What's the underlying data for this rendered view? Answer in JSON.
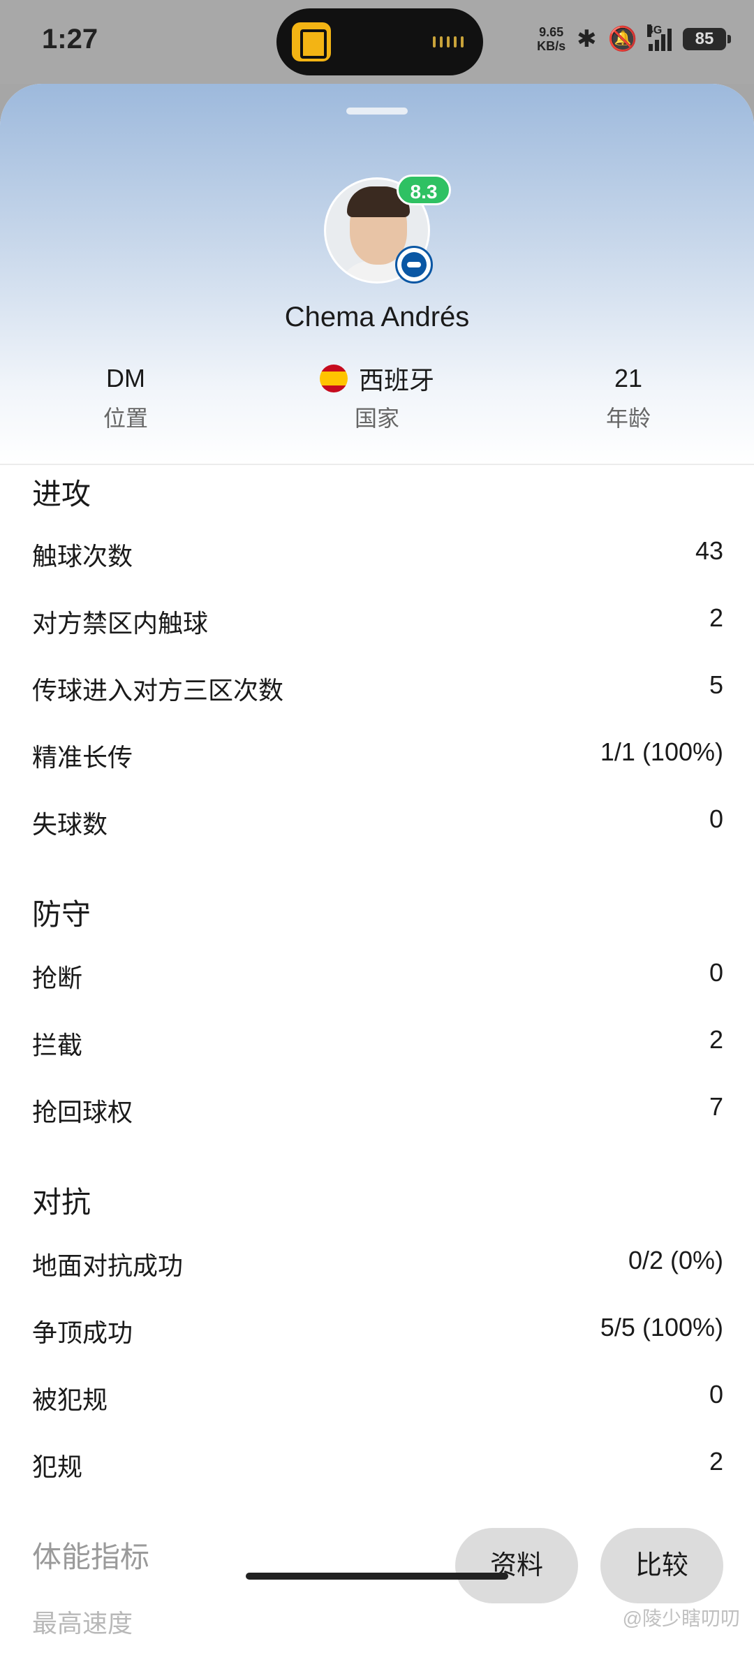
{
  "status_bar": {
    "time": "1:27",
    "net_speed_value": "9.65",
    "net_speed_unit": "KB/s",
    "network": "4G",
    "battery": "85"
  },
  "player": {
    "name": "Chema Andrés",
    "rating": "8.3",
    "position_value": "DM",
    "position_label": "位置",
    "country_value": "西班牙",
    "country_label": "国家",
    "age_value": "21",
    "age_label": "年龄"
  },
  "sections": {
    "attack": {
      "title": "进攻",
      "rows": [
        {
          "label": "触球次数",
          "value": "43"
        },
        {
          "label": "对方禁区内触球",
          "value": "2"
        },
        {
          "label": "传球进入对方三区次数",
          "value": "5"
        },
        {
          "label": "精准长传",
          "value": "1/1 (100%)"
        },
        {
          "label": "失球数",
          "value": "0"
        }
      ]
    },
    "defense": {
      "title": "防守",
      "rows": [
        {
          "label": "抢断",
          "value": "0"
        },
        {
          "label": "拦截",
          "value": "2"
        },
        {
          "label": "抢回球权",
          "value": "7"
        }
      ]
    },
    "duels": {
      "title": "对抗",
      "rows": [
        {
          "label": "地面对抗成功",
          "value": "0/2 (0%)"
        },
        {
          "label": "争顶成功",
          "value": "5/5 (100%)"
        },
        {
          "label": "被犯规",
          "value": "0"
        },
        {
          "label": "犯规",
          "value": "2"
        }
      ]
    },
    "physical": {
      "title": "体能指标",
      "rows": [
        {
          "label": "最高速度"
        }
      ]
    }
  },
  "buttons": {
    "profile": "资料",
    "compare": "比较"
  },
  "watermark": "@陵少瞎叨叨",
  "colors": {
    "rating_green": "#2fc163",
    "header_blue": "#9db9dc",
    "button_gray": "#dcdcdc"
  }
}
